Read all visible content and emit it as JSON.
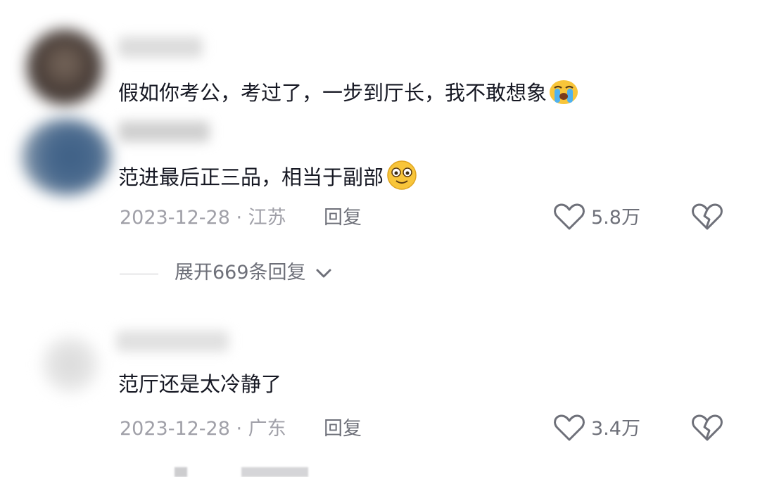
{
  "comments": [
    {
      "text": "假如你考公，考过了，一步到厅长，我不敢想象",
      "emoji": "crying-emoji"
    },
    {
      "text": "范进最后正三品，相当于副部",
      "emoji": "surprised-smile-emoji",
      "date_location": "2023-12-28 · 江苏",
      "reply_label": "回复",
      "likes": "5.8万",
      "expand_label": "展开669条回复"
    },
    {
      "text": "范厅还是太冷静了",
      "date_location": "2023-12-28 · 广东",
      "reply_label": "回复",
      "likes": "3.4万"
    }
  ],
  "icons": {
    "like": "heart-outline-icon",
    "dislike": "broken-heart-icon",
    "expand": "chevron-down-icon"
  },
  "colors": {
    "text_primary": "#161823",
    "text_secondary": "#a0a0a8",
    "text_action": "#6e7079"
  }
}
